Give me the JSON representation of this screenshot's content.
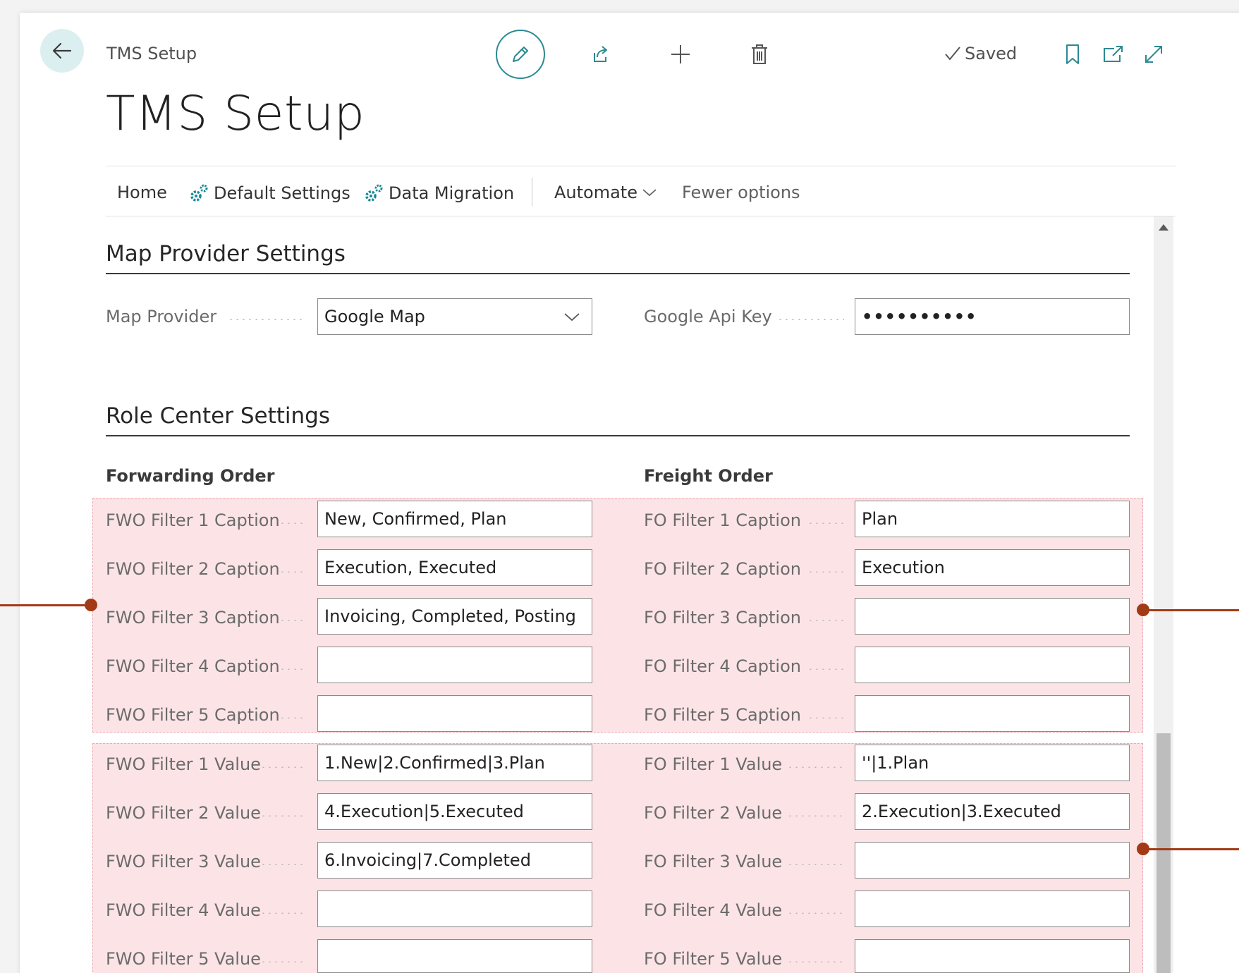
{
  "header": {
    "breadcrumb": "TMS Setup",
    "title": "TMS Setup",
    "saved_label": "Saved"
  },
  "actions": {
    "home": "Home",
    "default_settings": "Default Settings",
    "data_migration": "Data Migration",
    "automate": "Automate",
    "fewer_options": "Fewer options"
  },
  "map_provider": {
    "section_title": "Map Provider Settings",
    "provider_label": "Map Provider",
    "provider_value": "Google Map",
    "api_key_label": "Google Api Key",
    "api_key_value": "••••••••••"
  },
  "role_center": {
    "section_title": "Role Center Settings",
    "forwarding_header": "Forwarding Order",
    "freight_header": "Freight Order",
    "fwo_captions": [
      {
        "label": "FWO Filter 1 Caption",
        "value": "New, Confirmed, Plan"
      },
      {
        "label": "FWO Filter 2 Caption",
        "value": "Execution, Executed"
      },
      {
        "label": "FWO Filter 3 Caption",
        "value": "Invoicing, Completed, Posting"
      },
      {
        "label": "FWO Filter 4 Caption",
        "value": ""
      },
      {
        "label": "FWO Filter 5 Caption",
        "value": ""
      }
    ],
    "fo_captions": [
      {
        "label": "FO Filter 1 Caption",
        "value": "Plan"
      },
      {
        "label": "FO Filter 2 Caption",
        "value": "Execution"
      },
      {
        "label": "FO Filter 3 Caption",
        "value": ""
      },
      {
        "label": "FO Filter 4 Caption",
        "value": ""
      },
      {
        "label": "FO Filter 5 Caption",
        "value": ""
      }
    ],
    "fwo_values": [
      {
        "label": "FWO Filter 1 Value",
        "value": "1.New|2.Confirmed|3.Plan"
      },
      {
        "label": "FWO Filter 2 Value",
        "value": "4.Execution|5.Executed"
      },
      {
        "label": "FWO Filter 3 Value",
        "value": "6.Invoicing|7.Completed"
      },
      {
        "label": "FWO Filter 4 Value",
        "value": ""
      },
      {
        "label": "FWO Filter 5 Value",
        "value": ""
      }
    ],
    "fo_values": [
      {
        "label": "FO Filter 1 Value",
        "value": "''|1.Plan"
      },
      {
        "label": "FO Filter 2 Value",
        "value": "2.Execution|3.Executed"
      },
      {
        "label": "FO Filter 3 Value",
        "value": ""
      },
      {
        "label": "FO Filter 4 Value",
        "value": ""
      },
      {
        "label": "FO Filter 5 Value",
        "value": ""
      }
    ]
  },
  "colors": {
    "accent": "#2b8a92",
    "highlight": "#f6aab2",
    "callout": "#a33a16"
  }
}
